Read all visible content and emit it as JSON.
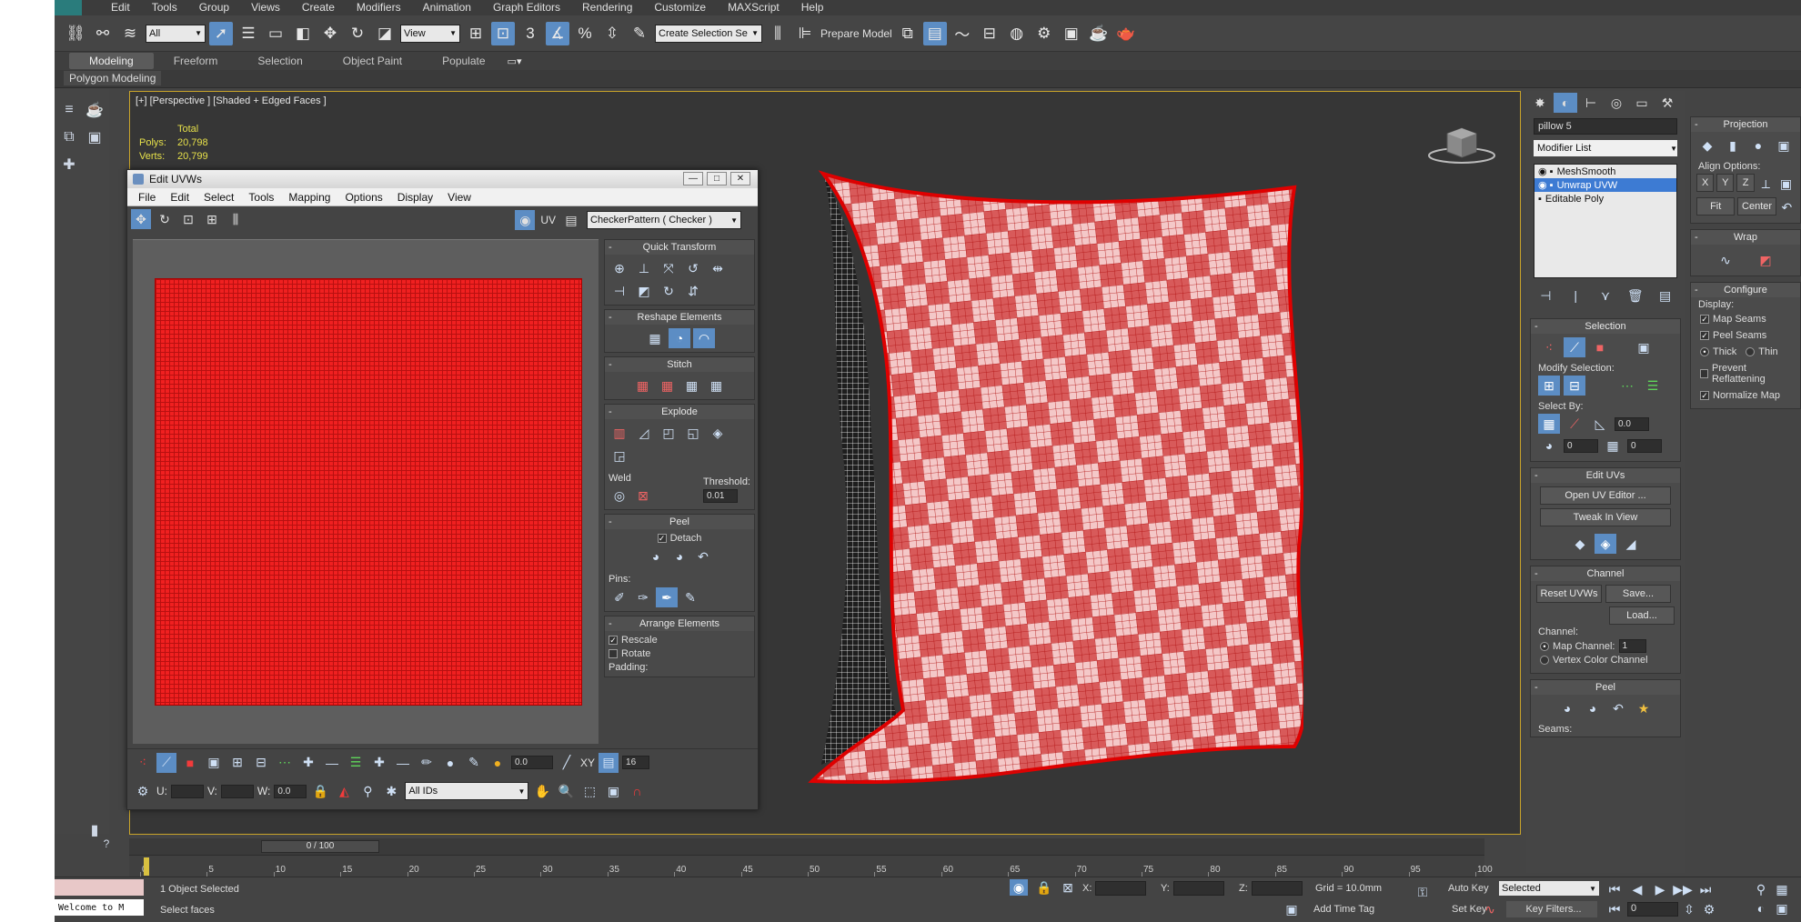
{
  "menu": [
    "Edit",
    "Tools",
    "Group",
    "Views",
    "Create",
    "Modifiers",
    "Animation",
    "Graph Editors",
    "Rendering",
    "Customize",
    "MAXScript",
    "Help"
  ],
  "toolbar": {
    "filter_select": "All",
    "ref_coord_select": "View",
    "named_selection": "Create Selection Se",
    "prepare_model_label": "Prepare Model",
    "snap_3": "3",
    "percent_snap": "%",
    "angle_snap": "n"
  },
  "ribbon": {
    "tabs": [
      "Modeling",
      "Freeform",
      "Selection",
      "Object Paint",
      "Populate"
    ],
    "active_tab": "Modeling",
    "sub_label": "Polygon Modeling"
  },
  "viewport": {
    "label": "[+] [Perspective ] [Shaded + Edged Faces ]",
    "stats": {
      "header": "Total",
      "polys_label": "Polys:",
      "polys_value": "20,798",
      "verts_label": "Verts:",
      "verts_value": "20,799"
    },
    "accent_color": "#c9a42a"
  },
  "uvw_editor": {
    "title": "Edit UVWs",
    "menu": [
      "File",
      "Edit",
      "Select",
      "Tools",
      "Mapping",
      "Options",
      "Display",
      "View"
    ],
    "uv_label": "UV",
    "texture_select": "CheckerPattern  ( Checker )",
    "rollouts": {
      "quick_transform": "Quick Transform",
      "reshape": "Reshape Elements",
      "stitch": "Stitch",
      "explode": "Explode",
      "weld_label": "Weld",
      "threshold_label": "Threshold:",
      "threshold_value": "0.01",
      "peel": "Peel",
      "detach_label": "Detach",
      "pins_label": "Pins:",
      "arrange": "Arrange Elements",
      "rescale_label": "Rescale",
      "rotate_label": "Rotate",
      "padding_label": "Padding:"
    },
    "bottom": {
      "soft_value": "0.0",
      "xy_label": "XY",
      "grid_value": "16",
      "u_label": "U:",
      "v_label": "V:",
      "w_label": "W:",
      "w_value": "0.0",
      "ids_select": "All IDs"
    },
    "uv_color": "#f02020"
  },
  "command_panel": {
    "object_name": "pillow 5",
    "modifier_list": "Modifier List",
    "stack": [
      "MeshSmooth",
      "Unwrap UVW",
      "Editable Poly"
    ],
    "selected_stack": "Unwrap UVW",
    "selection": {
      "title": "Selection",
      "modify_label": "Modify Selection:",
      "select_by_label": "Select By:",
      "spin1": "0.0",
      "spin2": "0",
      "spin3": "0"
    },
    "edit_uvs": {
      "title": "Edit UVs",
      "open_editor": "Open UV Editor ...",
      "tweak": "Tweak In View"
    },
    "channel": {
      "title": "Channel",
      "reset": "Reset UVWs",
      "save": "Save...",
      "load": "Load...",
      "channel_label": "Channel:",
      "map_channel": "Map Channel:",
      "map_channel_value": "1",
      "vertex_color": "Vertex Color Channel"
    },
    "peel": {
      "title": "Peel",
      "seams_label": "Seams:"
    }
  },
  "right_panel": {
    "projection_title": "Projection",
    "align_label": "Align Options:",
    "axes": [
      "X",
      "Y",
      "Z"
    ],
    "fit": "Fit",
    "center": "Center",
    "wrap_title": "Wrap",
    "configure_title": "Configure",
    "display_label": "Display:",
    "map_seams": "Map Seams",
    "peel_seams": "Peel Seams",
    "thick": "Thick",
    "thin": "Thin",
    "prevent_reflattening": "Prevent Reflattening",
    "normalize_map": "Normalize Map"
  },
  "timeline": {
    "slider_label": "0 / 100",
    "ticks": [
      "0",
      "5",
      "10",
      "15",
      "20",
      "25",
      "30",
      "35",
      "40",
      "45",
      "50",
      "55",
      "60",
      "65",
      "70",
      "75",
      "80",
      "85",
      "90",
      "95",
      "100"
    ]
  },
  "status": {
    "listener": "Welcome to M",
    "selected": "1 Object Selected",
    "prompt": "Select faces",
    "x_label": "X:",
    "y_label": "Y:",
    "z_label": "Z:",
    "grid": "Grid = 10.0mm",
    "add_time_tag": "Add Time Tag",
    "auto_key": "Auto Key",
    "set_key": "Set Key",
    "selected_select": "Selected",
    "key_filters": "Key Filters...",
    "frame_value": "0"
  }
}
